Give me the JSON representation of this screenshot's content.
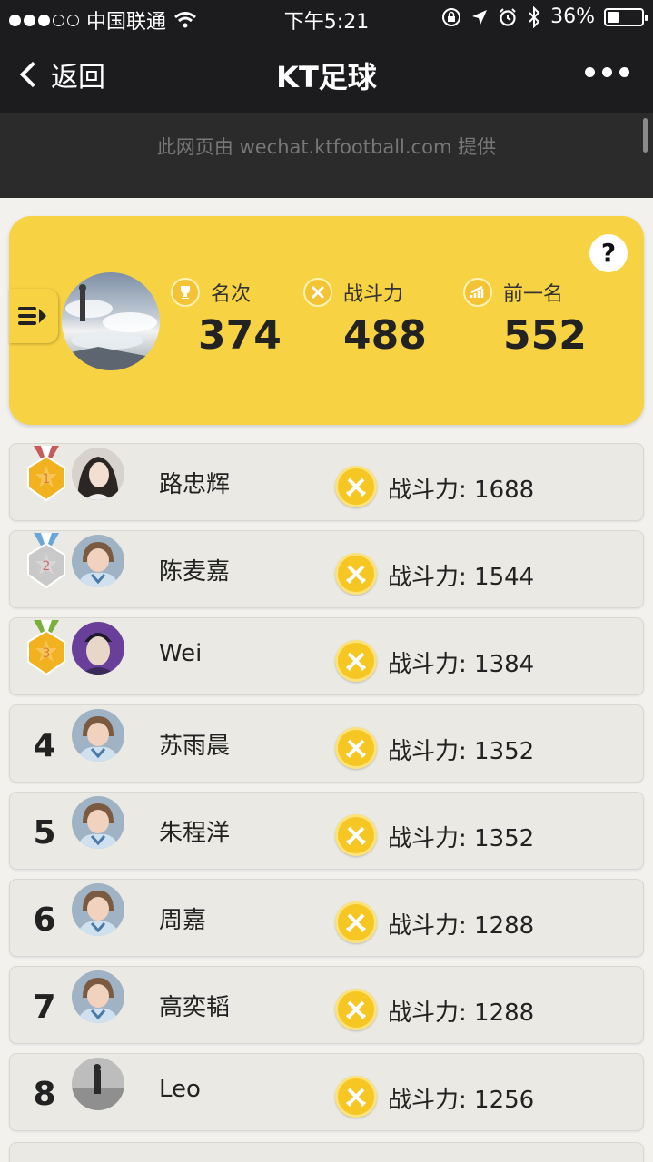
{
  "status_bar": {
    "carrier": "中国联通",
    "time": "下午5:21",
    "battery_percent": "36%",
    "battery_level": 0.36,
    "signal_dots_filled": 3,
    "signal_dots_total": 5
  },
  "nav": {
    "back_label": "返回",
    "title": "KT足球"
  },
  "provider_note": "此网页由 wechat.ktfootball.com 提供",
  "summary": {
    "stats": [
      {
        "label": "名次",
        "value": "374",
        "icon": "trophy-icon"
      },
      {
        "label": "战斗力",
        "value": "488",
        "icon": "crossed-swords-icon"
      },
      {
        "label": "前一名",
        "value": "552",
        "icon": "bar-chart-icon"
      }
    ],
    "help_label": "?"
  },
  "power_prefix": "战斗力:",
  "colors": {
    "accent_yellow": "#f7d343",
    "coin": "#f6c623",
    "gold_medal": "#f2b21f",
    "silver_medal": "#c9c9c9",
    "bronze_medal": "#f2b21f"
  },
  "rankings": [
    {
      "rank": "1",
      "medal": "gold",
      "name": "路忠辉",
      "power": "1688",
      "avatar": "woman"
    },
    {
      "rank": "2",
      "medal": "silver",
      "name": "陈麦嘉",
      "power": "1544",
      "avatar": "default"
    },
    {
      "rank": "3",
      "medal": "bronze",
      "name": "Wei",
      "power": "1384",
      "avatar": "cartoon"
    },
    {
      "rank": "4",
      "medal": "",
      "name": "苏雨晨",
      "power": "1352",
      "avatar": "default"
    },
    {
      "rank": "5",
      "medal": "",
      "name": "朱程洋",
      "power": "1352",
      "avatar": "default"
    },
    {
      "rank": "6",
      "medal": "",
      "name": "周嘉",
      "power": "1288",
      "avatar": "default"
    },
    {
      "rank": "7",
      "medal": "",
      "name": "高奕韬",
      "power": "1288",
      "avatar": "default"
    },
    {
      "rank": "8",
      "medal": "",
      "name": "Leo",
      "power": "1256",
      "avatar": "photo"
    }
  ]
}
